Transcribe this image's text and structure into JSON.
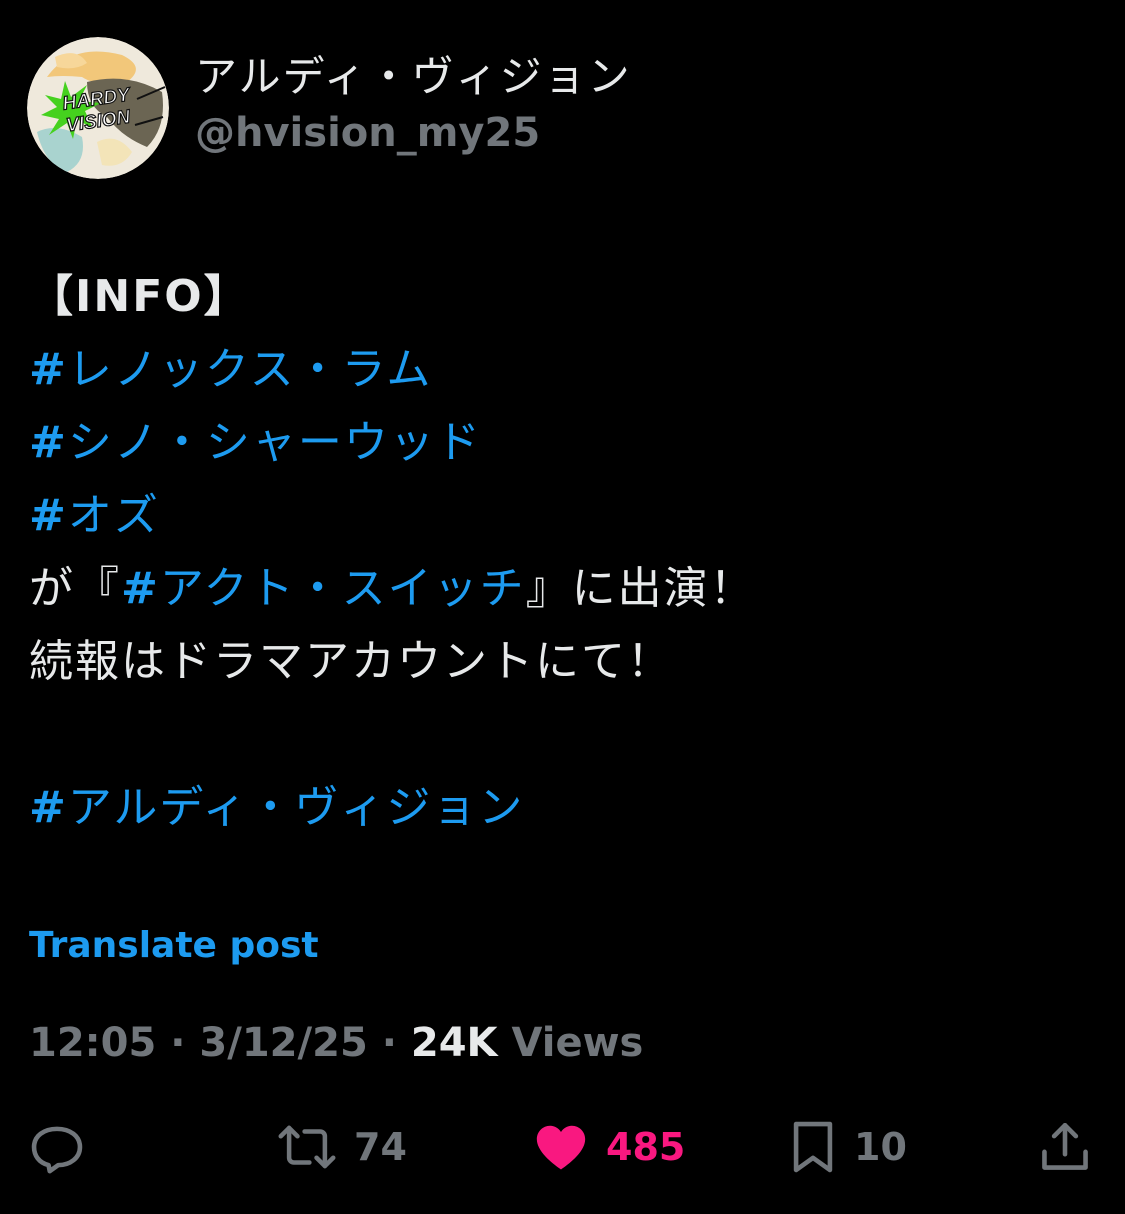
{
  "author": {
    "display_name": "アルディ・ヴィジョン",
    "handle": "@hvision_my25",
    "avatar_logo_text": "HARDY VISION"
  },
  "post": {
    "info_label": "【INFO】",
    "hashtags": {
      "tag1": "レノックス・ラム",
      "tag2": "シノ・シャーウッド",
      "tag3": "オズ",
      "tag4": "アクト・スイッチ",
      "tag5": "アルディ・ヴィジョン"
    },
    "hash_symbol": "#",
    "line5_prefix": "が『",
    "line5_suffix": "』に出演！",
    "line6": "続報はドラマアカウントにて！"
  },
  "translate_label": "Translate post",
  "meta": {
    "time": "12:05",
    "date": "3/12/25",
    "separator": "·",
    "views_count": "24K",
    "views_label": "Views"
  },
  "actions": {
    "reply_count": "",
    "retweet_count": "74",
    "like_count": "485",
    "bookmark_count": "10"
  },
  "colors": {
    "background": "#000000",
    "text": "#e7e9ea",
    "secondary": "#71767b",
    "link": "#1d9bf0",
    "like": "#f91880"
  },
  "icons": {
    "reply": "reply-icon",
    "retweet": "retweet-icon",
    "like": "heart-icon",
    "bookmark": "bookmark-icon",
    "share": "share-icon"
  }
}
